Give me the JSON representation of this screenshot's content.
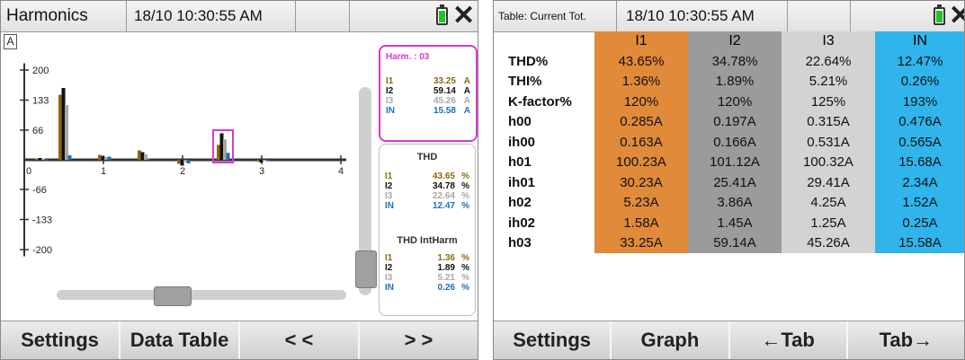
{
  "left": {
    "header": {
      "title": "Harmonics",
      "timestamp": "18/10 10:30:55 AM"
    },
    "unit_badge": "A",
    "chart": {
      "y_ticks": [
        "200",
        "133",
        "66",
        "-66",
        "-133",
        "-200"
      ],
      "x_ticks": [
        "0",
        "1",
        "2",
        "3",
        "4"
      ]
    },
    "harm_panel": {
      "title": "Harm. :  03",
      "rows": [
        {
          "label": "I1",
          "value": "33.25",
          "unit": "A"
        },
        {
          "label": "I2",
          "value": "59.14",
          "unit": "A"
        },
        {
          "label": "I3",
          "value": "45.26",
          "unit": "A"
        },
        {
          "label": "IN",
          "value": "15.58",
          "unit": "A"
        }
      ]
    },
    "thd_panel": {
      "title": "THD",
      "rows": [
        {
          "label": "I1",
          "value": "43.65",
          "unit": "%"
        },
        {
          "label": "I2",
          "value": "34.78",
          "unit": "%"
        },
        {
          "label": "I3",
          "value": "22.64",
          "unit": "%"
        },
        {
          "label": "IN",
          "value": "12.47",
          "unit": "%"
        }
      ],
      "subtitle": "THD IntHarm",
      "rows2": [
        {
          "label": "I1",
          "value": "1.36",
          "unit": "%"
        },
        {
          "label": "I2",
          "value": "1.89",
          "unit": "%"
        },
        {
          "label": "I3",
          "value": "5.21",
          "unit": "%"
        },
        {
          "label": "IN",
          "value": "0.26",
          "unit": "%"
        }
      ]
    },
    "footer": [
      "Settings",
      "Data Table",
      "< <",
      "> >"
    ]
  },
  "right": {
    "header": {
      "title": "Table: Current Tot.",
      "timestamp": "18/10 10:30:55 AM"
    },
    "columns": [
      "I1",
      "I2",
      "I3",
      "IN"
    ],
    "rows": [
      {
        "label": "THD%",
        "values": [
          "43.65%",
          "34.78%",
          "22.64%",
          "12.47%"
        ]
      },
      {
        "label": "THI%",
        "values": [
          "1.36%",
          "1.89%",
          "5.21%",
          "0.26%"
        ]
      },
      {
        "label": "K-factor%",
        "values": [
          "120%",
          "120%",
          "125%",
          "193%"
        ]
      },
      {
        "label": "h00",
        "values": [
          "0.285A",
          "0.197A",
          "0.315A",
          "0.476A"
        ]
      },
      {
        "label": "ih00",
        "values": [
          "0.163A",
          "0.166A",
          "0.531A",
          "0.565A"
        ]
      },
      {
        "label": "h01",
        "values": [
          "100.23A",
          "101.12A",
          "100.32A",
          "15.68A"
        ]
      },
      {
        "label": "ih01",
        "values": [
          "30.23A",
          "25.41A",
          "29.41A",
          "2.34A"
        ]
      },
      {
        "label": "h02",
        "values": [
          "5.23A",
          "3.86A",
          "4.25A",
          "1.52A"
        ]
      },
      {
        "label": "ih02",
        "values": [
          "1.58A",
          "1.45A",
          "1.25A",
          "0.25A"
        ]
      },
      {
        "label": "h03",
        "values": [
          "33.25A",
          "59.14A",
          "45.26A",
          "15.58A"
        ]
      }
    ],
    "footer": [
      "Settings",
      "Graph",
      "←Tab",
      "Tab→"
    ]
  },
  "colors": {
    "I1": "#8a6a12",
    "I2": "#111111",
    "I3": "#a8a8a8",
    "IN": "#1f6fb3"
  }
}
